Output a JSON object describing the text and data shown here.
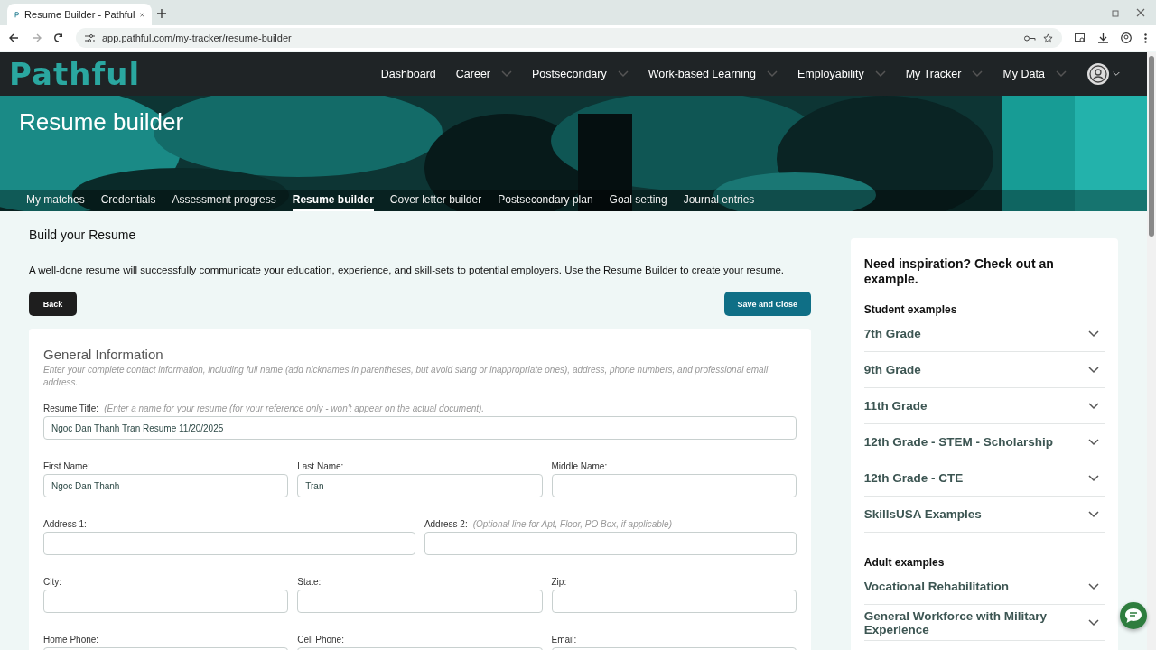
{
  "browser": {
    "tab_title": "Resume Builder - Pathful",
    "url": "app.pathful.com/my-tracker/resume-builder"
  },
  "nav": {
    "logo": "Pathful",
    "items": [
      {
        "label": "Dashboard",
        "dropdown": false
      },
      {
        "label": "Career",
        "dropdown": true
      },
      {
        "label": "Postsecondary",
        "dropdown": true
      },
      {
        "label": "Work-based Learning",
        "dropdown": true
      },
      {
        "label": "Employability",
        "dropdown": true
      },
      {
        "label": "My Tracker",
        "dropdown": true
      },
      {
        "label": "My Data",
        "dropdown": true
      }
    ]
  },
  "hero": {
    "title": "Resume builder",
    "tabs": [
      {
        "label": "My matches",
        "selected": false
      },
      {
        "label": "Credentials",
        "selected": false
      },
      {
        "label": "Assessment progress",
        "selected": false
      },
      {
        "label": "Resume builder",
        "selected": true
      },
      {
        "label": "Cover letter builder",
        "selected": false
      },
      {
        "label": "Postsecondary plan",
        "selected": false
      },
      {
        "label": "Goal setting",
        "selected": false
      },
      {
        "label": "Journal entries",
        "selected": false
      }
    ]
  },
  "intro": {
    "heading": "Build your Resume",
    "text": "A well-done resume will successfully communicate your education, experience, and skill-sets to potential employers. Use the Resume Builder to create your resume."
  },
  "buttons": {
    "back": "Back",
    "save": "Save and Close"
  },
  "form": {
    "title": "General Information",
    "hint": "Enter your complete contact information, including full name (add nicknames in parentheses, but avoid slang or inappropriate ones), address, phone numbers, and professional email address.",
    "field_groups": [
      {
        "fields": [
          {
            "label": "Resume Title:",
            "hint": "(Enter a name for your resume (for your reference only - won't appear on the actual document).",
            "value": "Ngoc Dan Thanh Tran Resume 11/20/2025"
          }
        ]
      },
      {
        "fields": [
          {
            "label": "First Name:",
            "value": "Ngoc Dan Thanh"
          },
          {
            "label": "Last Name:",
            "value": "Tran"
          },
          {
            "label": "Middle Name:"
          }
        ]
      },
      {
        "fields": [
          {
            "label": "Address 1:"
          },
          {
            "label": "Address 2:",
            "hint": "(Optional line for Apt, Floor, PO Box, if applicable)"
          }
        ]
      },
      {
        "fields": [
          {
            "label": "City:"
          },
          {
            "label": "State:"
          },
          {
            "label": "Zip:"
          }
        ]
      },
      {
        "fields": [
          {
            "label": "Home Phone:"
          },
          {
            "label": "Cell Phone:"
          },
          {
            "label": "Email:"
          }
        ]
      }
    ]
  },
  "sidebar": {
    "title": "Need inspiration? Check out an example.",
    "groups": [
      {
        "heading": "Student examples",
        "items": [
          "7th Grade",
          "9th Grade",
          "11th Grade",
          "12th Grade - STEM - Scholarship",
          "12th Grade - CTE",
          "SkillsUSA Examples"
        ]
      },
      {
        "heading": "Adult examples",
        "items": [
          "Vocational Rehabilitation",
          "General Workforce with Military Experience"
        ]
      }
    ]
  }
}
